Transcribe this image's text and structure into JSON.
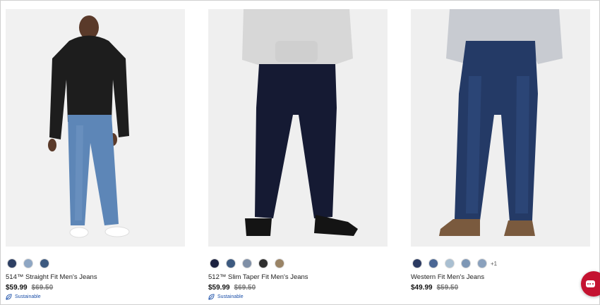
{
  "products": [
    {
      "name": "514™ Straight Fit Men's Jeans",
      "price": "$59.99",
      "original_price": "$69.50",
      "badge": "Sustainable",
      "swatches": [
        "#2d3f63",
        "#8ea6c3",
        "#3d5a80"
      ],
      "more": ""
    },
    {
      "name": "512™ Slim Taper Fit Men's Jeans",
      "price": "$59.99",
      "original_price": "$69.50",
      "badge": "Sustainable",
      "swatches": [
        "#1c2240",
        "#3d5a80",
        "#7f8fa6",
        "#2f2f2f",
        "#9a8466"
      ],
      "more": ""
    },
    {
      "name": "Western Fit Men's Jeans",
      "price": "$49.99",
      "original_price": "$59.50",
      "badge": "",
      "swatches": [
        "#2b3a61",
        "#4a6694",
        "#a9bfd1",
        "#7d97b5",
        "#8aa1bd"
      ],
      "more": "+1"
    }
  ],
  "chat": {
    "icon": "chat-bubble-icon",
    "color": "#c41230"
  }
}
